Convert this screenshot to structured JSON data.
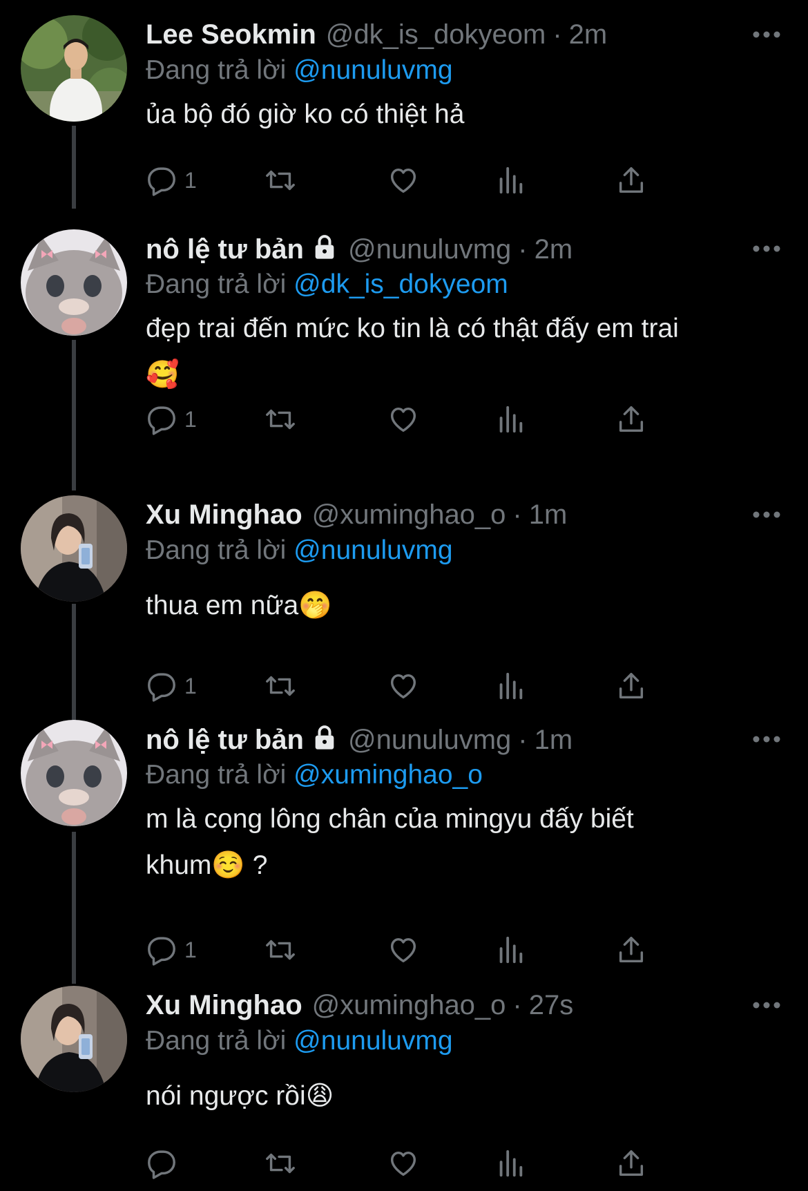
{
  "colors": {
    "background": "#000000",
    "text_primary": "#e7e9ea",
    "text_secondary": "#71767b",
    "link": "#1d9bf0",
    "icon": "#71767b",
    "thread_line": "#3a3d41"
  },
  "replying_prefix": "Đang trả lời",
  "tweets": [
    {
      "display_name": "Lee Seokmin",
      "handle": "@dk_is_dokyeom",
      "time": "2m",
      "replying_to": "@nunuluvmg",
      "text": "ủa bộ đó giờ ko có thiệt hả",
      "reply_count": "1",
      "avatar": "man-outdoors-avatar",
      "locked": false
    },
    {
      "display_name": "nô lệ tư bản",
      "handle": "@nunuluvmg",
      "time": "2m",
      "replying_to": "@dk_is_dokyeom",
      "text": "đẹp trai đến mức ko tin là có thật đấy em trai\n🥰",
      "reply_count": "1",
      "avatar": "kitten-avatar",
      "locked": true
    },
    {
      "display_name": "Xu Minghao",
      "handle": "@xuminghao_o",
      "time": "1m",
      "replying_to": "@nunuluvmg",
      "text": "thua em nữa🤭",
      "reply_count": "1",
      "avatar": "mirror-selfie-avatar",
      "locked": false
    },
    {
      "display_name": "nô lệ tư bản",
      "handle": "@nunuluvmg",
      "time": "1m",
      "replying_to": "@xuminghao_o",
      "text": "m là cọng lông chân của mingyu đấy biết\nkhum☺️ ?",
      "reply_count": "1",
      "avatar": "kitten-avatar",
      "locked": true
    },
    {
      "display_name": "Xu Minghao",
      "handle": "@xuminghao_o",
      "time": "27s",
      "replying_to": "@nunuluvmg",
      "text": "nói ngược rồi😩",
      "reply_count": "",
      "avatar": "mirror-selfie-avatar",
      "locked": false
    }
  ]
}
